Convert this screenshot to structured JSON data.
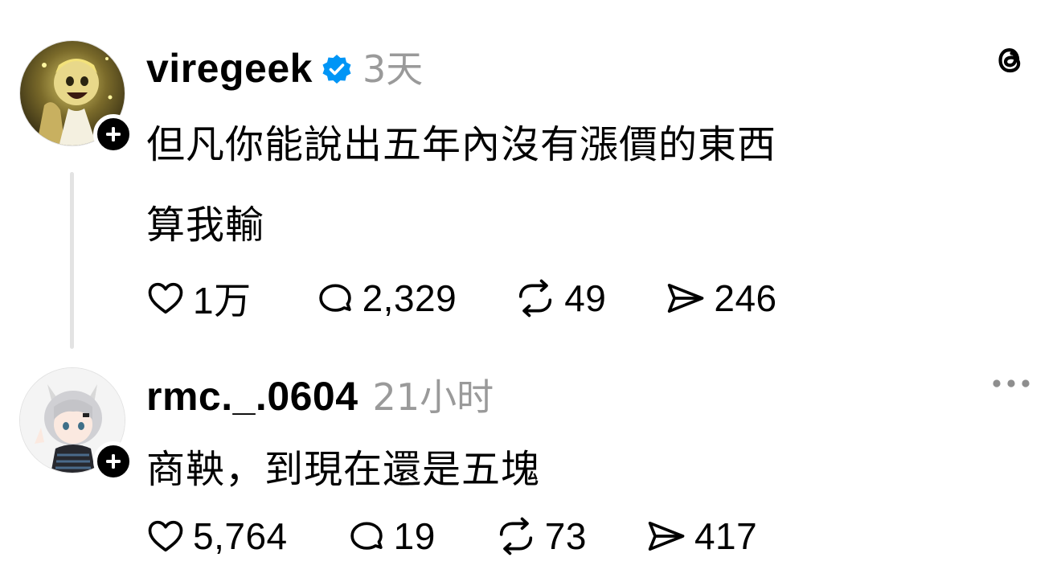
{
  "post": {
    "username": "viregeek",
    "timestamp": "3天",
    "lines": [
      "但凡你能說出五年內沒有漲價的東西",
      "算我輸"
    ],
    "likes": "1万",
    "replies": "2,329",
    "reposts": "49",
    "shares": "246",
    "verified": true
  },
  "reply": {
    "username": "rmc._.0604",
    "timestamp": "21小时",
    "text": "商鞅，到現在還是五塊",
    "likes": "5,764",
    "replies": "19",
    "reposts": "73",
    "shares": "417"
  },
  "colors": {
    "verified_blue": "#0095F6",
    "muted_text": "#9A9A9A",
    "thread_line": "#E3E3E3"
  },
  "icons": {
    "app_logo": "threads-logo-icon",
    "more": "more-horizontal-icon",
    "like": "heart-icon",
    "reply": "comment-icon",
    "repost": "repost-icon",
    "share": "send-icon"
  }
}
